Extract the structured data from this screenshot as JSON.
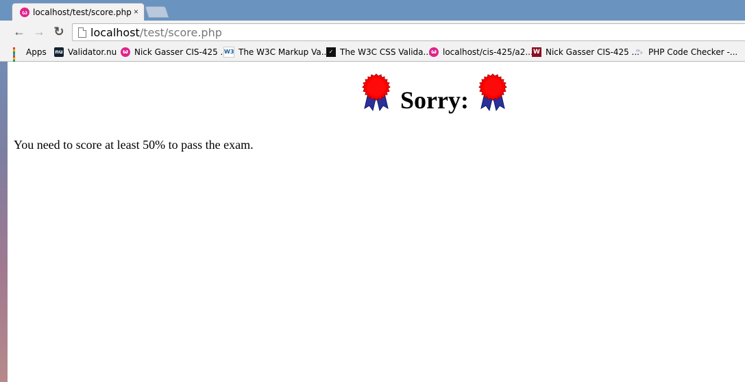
{
  "browser": {
    "tab": {
      "title": "localhost/test/score.php",
      "close": "×"
    },
    "nav": {
      "back": "←",
      "forward": "→",
      "reload": "↻"
    },
    "url": {
      "host": "localhost",
      "path": "/test/score.php"
    },
    "bookmarks": [
      {
        "label": "Apps",
        "icon": "apps-grid-icon"
      },
      {
        "label": "Validator.nu",
        "icon": "validator-nu-icon"
      },
      {
        "label": "Nick Gasser CIS-425 ...",
        "icon": "wamp-icon"
      },
      {
        "label": "The W3C Markup Va...",
        "icon": "w3c-icon"
      },
      {
        "label": "The W3C CSS Valida...",
        "icon": "css-validator-icon"
      },
      {
        "label": "localhost/cis-425/a2...",
        "icon": "wamp-icon"
      },
      {
        "label": "Nick Gasser CIS-425 ...",
        "icon": "w-icon"
      },
      {
        "label": "PHP Code Checker -...",
        "icon": "php-icon"
      }
    ]
  },
  "page": {
    "heading": "Sorry:",
    "message": "You need to score at least 50% to pass the exam."
  },
  "colors": {
    "ribbon_red": "#ff0000",
    "ribbon_blue": "#2a2f9a",
    "frame_blue": "#6b93c0"
  }
}
